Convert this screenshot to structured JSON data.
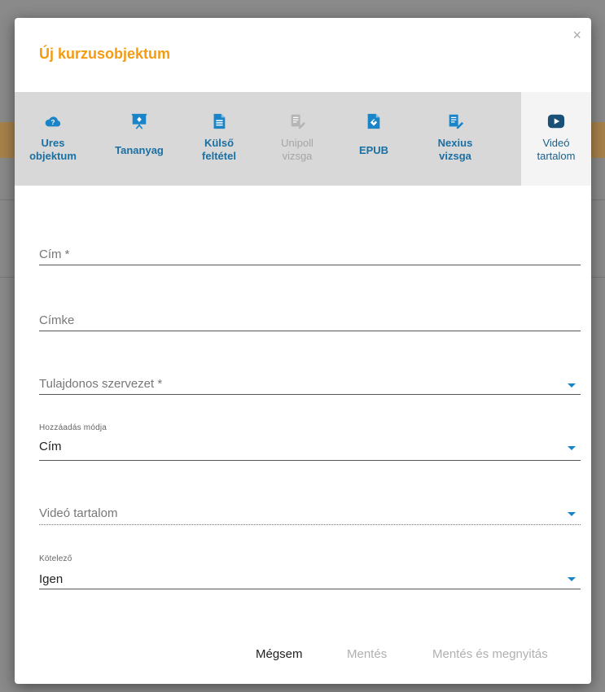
{
  "dialog": {
    "title": "Új kurzusobjektum",
    "close_glyph": "×"
  },
  "types": [
    {
      "label": "Ures\nobjektum",
      "icon": "cloud-question-icon",
      "state": "enabled"
    },
    {
      "label": "Tananyag",
      "icon": "presentation-board-icon",
      "state": "enabled"
    },
    {
      "label": "Külső\nfeltétel",
      "icon": "document-icon",
      "state": "enabled"
    },
    {
      "label": "Unipoll\nvizsga",
      "icon": "pencil-list-icon",
      "state": "disabled"
    },
    {
      "label": "EPUB",
      "icon": "epub-file-icon",
      "state": "enabled"
    },
    {
      "label": "Nexius\nvizsga",
      "icon": "exam-list-icon",
      "state": "enabled"
    },
    {
      "label": "Videó\ntartalom",
      "icon": "play-icon",
      "state": "active"
    }
  ],
  "form": {
    "title_placeholder": "Cím *",
    "tag_placeholder": "Címke",
    "owner_placeholder": "Tulajdonos szervezet *",
    "add_mode_label": "Hozzáadás módja",
    "add_mode_value": "Cím",
    "video_placeholder": "Videó tartalom",
    "required_label": "Kötelező",
    "required_value": "Igen"
  },
  "footer": {
    "cancel": "Mégsem",
    "save": "Mentés",
    "save_open": "Mentés és megnyitás"
  },
  "colors": {
    "accent": "#f39c12",
    "link_blue": "#1a6fa3",
    "icon_blue": "#1a84c8",
    "active_icon": "#1a4f78",
    "disabled": "#a5a5a5"
  }
}
